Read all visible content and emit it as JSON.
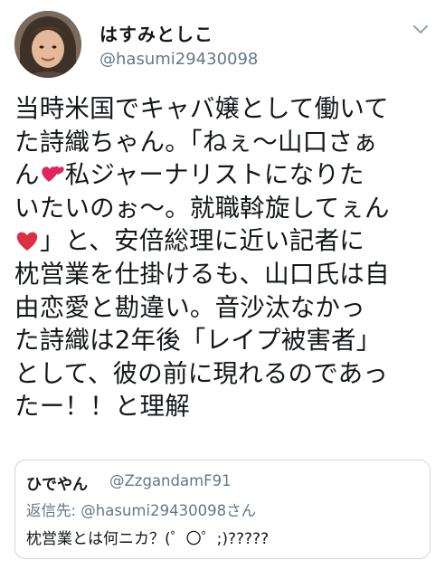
{
  "author": {
    "display_name": "はすみとしこ",
    "handle": "@hasumi29430098"
  },
  "tweet": {
    "line1": "当時米国でキャバ嬢として働いて",
    "line2": "た詩織ちゃん。「ねぇ〜山口さぁ",
    "line3a": "ん",
    "line3b": "私ジャーナリストになりた",
    "line4": "いたいのぉ〜。就職斡旋してぇん",
    "line5b": "」と、安倍総理に近い記者に",
    "line6": "枕営業を仕掛けるも、山口氏は自",
    "line7": "由恋愛と勘違い。音沙汰なかっ",
    "line8": "た詩織は2年後「レイプ被害者」",
    "line9": "として、彼の前に現れるのであっ",
    "line10": "たー！！と理解",
    "emoji1": "two-hearts-icon",
    "emoji2": "red-heart-icon"
  },
  "quoted": {
    "display_name": "ひでやん",
    "handle": "@ZzgandamF91",
    "reply_to": "返信先: @hasumi29430098さん",
    "text": "枕営業とは何ニカ？(゜〇゜;)?????"
  },
  "colors": {
    "text": "#14171a",
    "secondary": "#657786",
    "border": "#ccd6dd",
    "heart": "#e0245e"
  }
}
